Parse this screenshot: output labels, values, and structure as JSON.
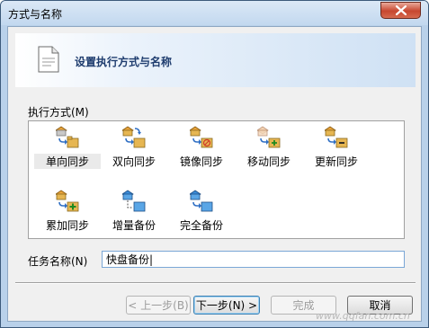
{
  "window": {
    "title": "方式与名称"
  },
  "header": {
    "title": "设置执行方式与名称"
  },
  "modes": {
    "label": "执行方式(M)",
    "items": [
      {
        "label": "单向同步",
        "icon": "one-way-sync-icon",
        "selected": true
      },
      {
        "label": "双向同步",
        "icon": "two-way-sync-icon",
        "selected": false
      },
      {
        "label": "镜像同步",
        "icon": "mirror-sync-icon",
        "selected": false
      },
      {
        "label": "移动同步",
        "icon": "move-sync-icon",
        "selected": false
      },
      {
        "label": "更新同步",
        "icon": "update-sync-icon",
        "selected": false
      },
      {
        "label": "累加同步",
        "icon": "cumulative-sync-icon",
        "selected": false
      },
      {
        "label": "增量备份",
        "icon": "incremental-backup-icon",
        "selected": false
      },
      {
        "label": "完全备份",
        "icon": "full-backup-icon",
        "selected": false
      }
    ]
  },
  "task_name": {
    "label": "任务名称(N)",
    "value": "快盘备份|"
  },
  "buttons": {
    "prev": "< 上一步(B)",
    "next": "下一步(N) >",
    "finish": "完成",
    "cancel": "取消"
  },
  "watermark": "www.qqfan.com.cn"
}
